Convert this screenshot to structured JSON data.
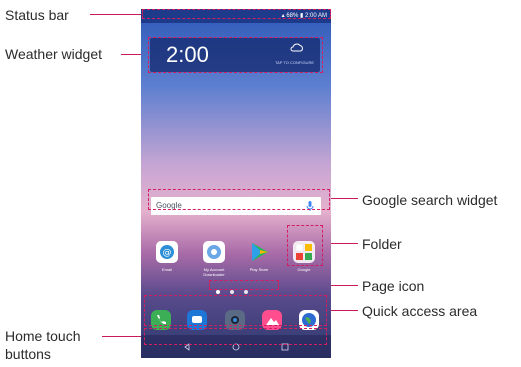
{
  "labels": {
    "status_bar": "Status bar",
    "weather_widget": "Weather widget",
    "google_search_widget": "Google search widget",
    "folder": "Folder",
    "page_icon": "Page icon",
    "quick_access_area": "Quick access area",
    "home_touch_buttons_line1": "Home touch",
    "home_touch_buttons_line2": "buttons"
  },
  "phone": {
    "status_time": "2:00 AM",
    "status_battery": "68%",
    "clock": "2:00",
    "tap_to_configure": "TAP TO CONFIGURE",
    "search_logo": "Google",
    "apps": [
      {
        "label": "Email",
        "icon": "email-icon"
      },
      {
        "label": "My Account Downloader",
        "icon": "fan-icon"
      },
      {
        "label": "Play Store",
        "icon": "play-store-icon"
      },
      {
        "label": "Google",
        "icon": "google-folder-icon"
      }
    ],
    "dock": [
      {
        "icon": "phone-icon",
        "color": "#3cae55"
      },
      {
        "icon": "messages-icon",
        "color": "#1e76d6"
      },
      {
        "icon": "camera-icon",
        "color": "#5a6a85"
      },
      {
        "icon": "gallery-icon",
        "color": "#ff4d8d"
      },
      {
        "icon": "browser-icon",
        "color": "#2d6bd3"
      }
    ]
  },
  "accent_color": "#cc1b5c"
}
